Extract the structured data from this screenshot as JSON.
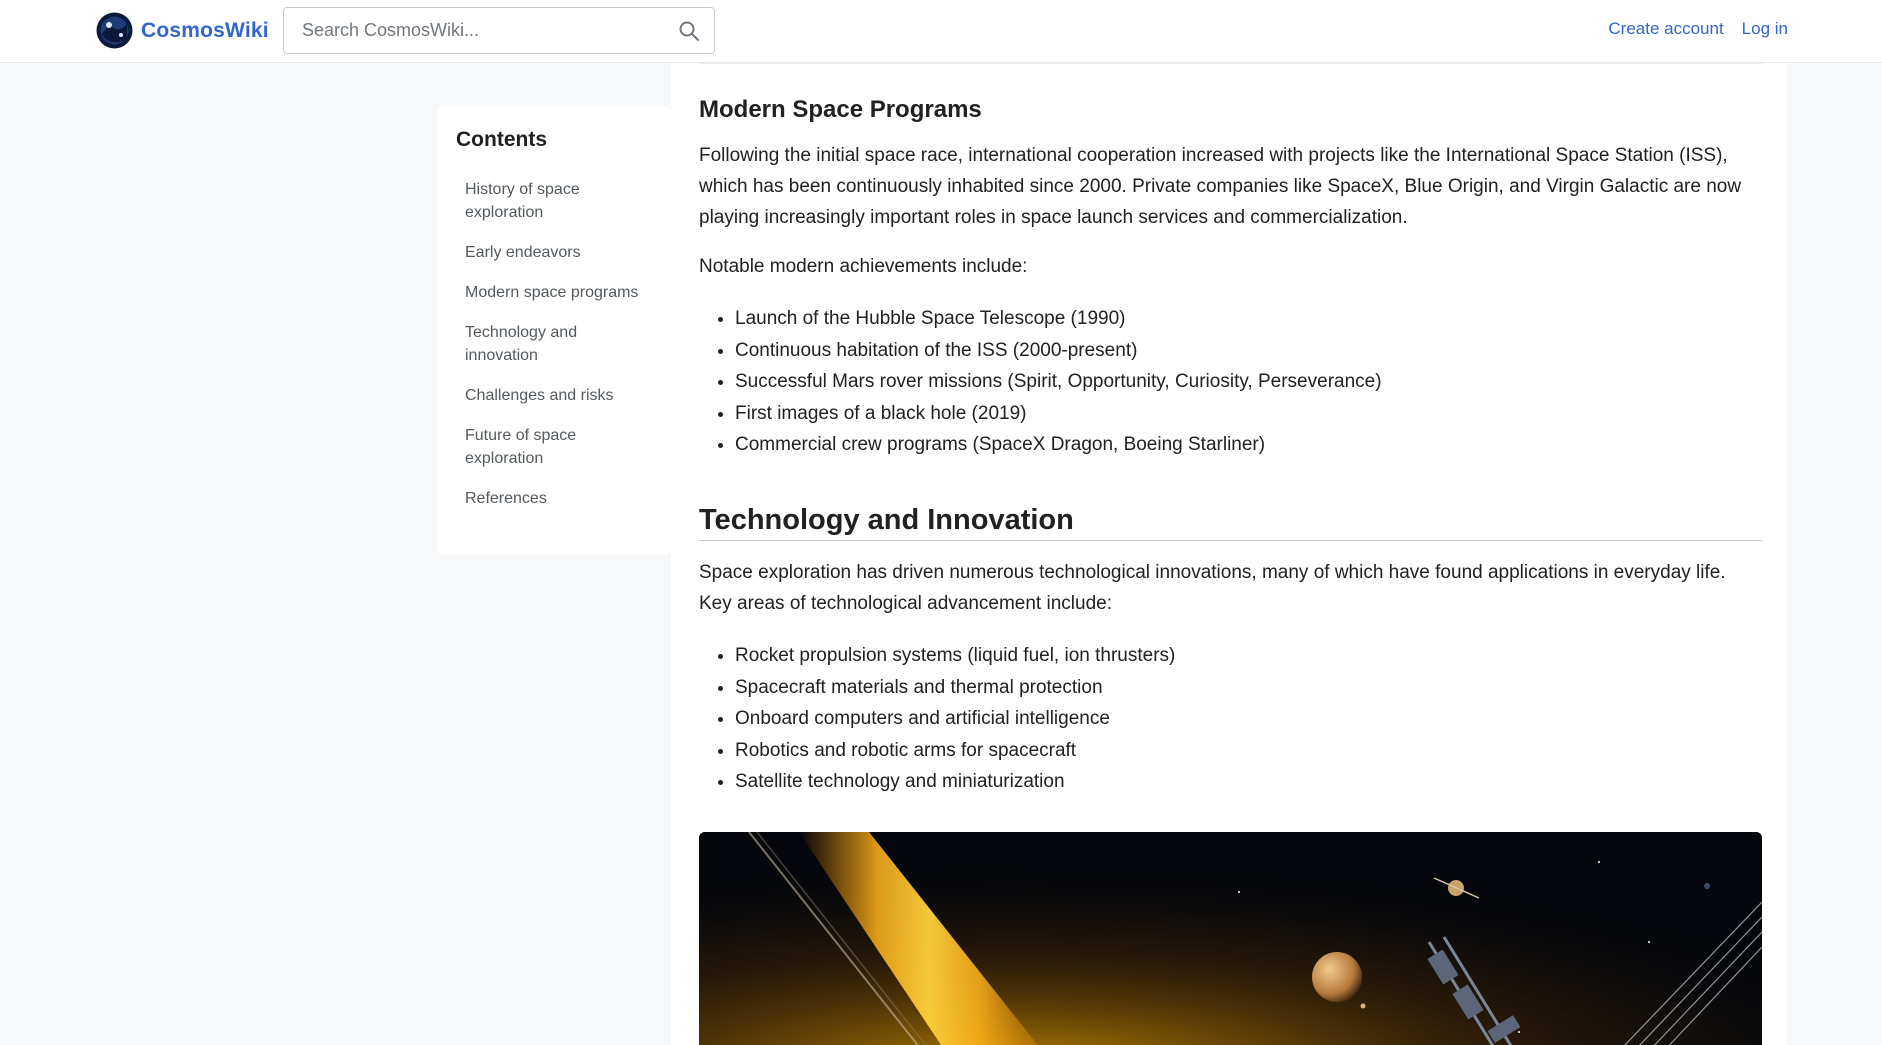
{
  "header": {
    "site_name": "CosmosWiki",
    "search_placeholder": "Search CosmosWiki...",
    "create_account": "Create account",
    "log_in": "Log in"
  },
  "toc": {
    "title": "Contents",
    "items": [
      "History of space exploration",
      "Early endeavors",
      "Modern space programs",
      "Technology and innovation",
      "Challenges and risks",
      "Future of space exploration",
      "References"
    ]
  },
  "modern": {
    "heading": "Modern Space Programs",
    "paragraph": "Following the initial space race, international cooperation increased with projects like the International Space Station (ISS), which has been continuously inhabited since 2000. Private companies like SpaceX, Blue Origin, and Virgin Galactic are now playing increasingly important roles in space launch services and commercialization.",
    "intro": "Notable modern achievements include:",
    "items": [
      "Launch of the Hubble Space Telescope (1990)",
      "Continuous habitation of the ISS (2000-present)",
      "Successful Mars rover missions (Spirit, Opportunity, Curiosity, Perseverance)",
      "First images of a black hole (2019)",
      "Commercial crew programs (SpaceX Dragon, Boeing Starliner)"
    ]
  },
  "technology": {
    "heading": "Technology and Innovation",
    "paragraph": "Space exploration has driven numerous technological innovations, many of which have found applications in everyday life. Key areas of technological advancement include:",
    "items": [
      "Rocket propulsion systems (liquid fuel, ion thrusters)",
      "Spacecraft materials and thermal protection",
      "Onboard computers and artificial intelligence",
      "Robotics and robotic arms for spacecraft",
      "Satellite technology and miniaturization"
    ]
  },
  "colors": {
    "link": "#3366cc",
    "text": "#202122",
    "muted": "#54595d",
    "page_bg": "#f7f8fa"
  },
  "icons": {
    "logo": "planet-logo-icon",
    "search": "search-icon"
  }
}
